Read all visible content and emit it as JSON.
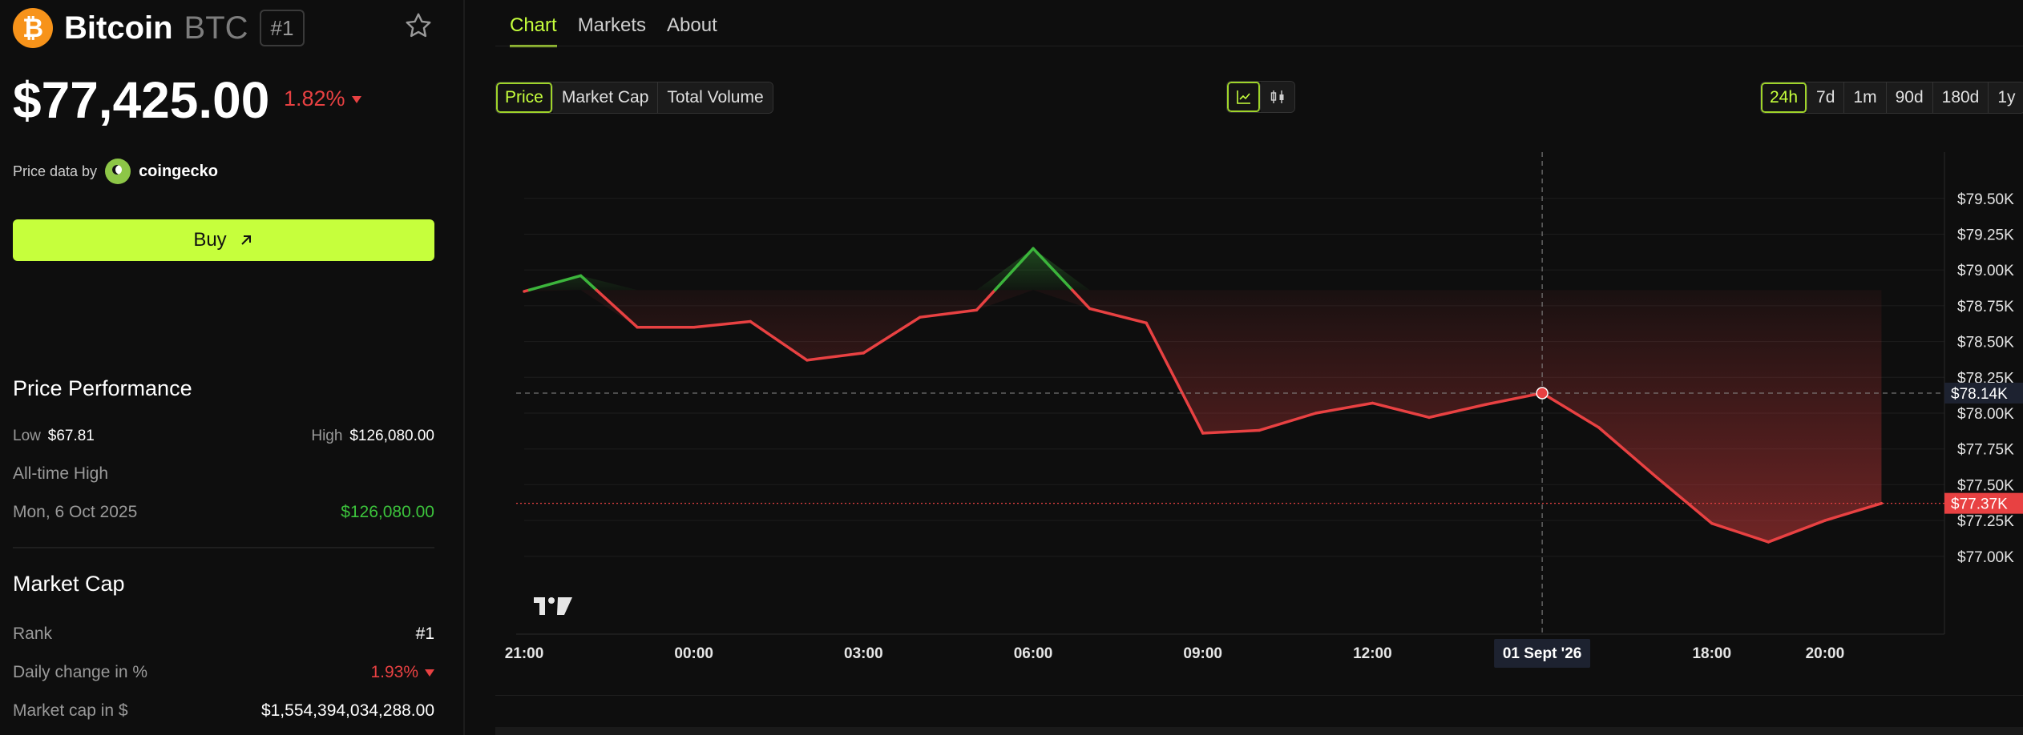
{
  "coin": {
    "name": "Bitcoin",
    "symbol": "BTC",
    "rank_badge": "#1",
    "logo_glyph": "₿",
    "price": "$77,425.00",
    "change": "1.82%"
  },
  "provider": {
    "label": "Price data by",
    "name": "coingecko"
  },
  "buy": {
    "label": "Buy"
  },
  "performance": {
    "title": "Price Performance",
    "low_label": "Low",
    "low_value": "$67.81",
    "high_label": "High",
    "high_value": "$126,080.00",
    "ath_label": "All-time High",
    "ath_date": "Mon, 6 Oct 2025",
    "ath_value": "$126,080.00"
  },
  "market_cap": {
    "title": "Market Cap",
    "rank_label": "Rank",
    "rank_value": "#1",
    "daily_label": "Daily change in %",
    "daily_value": "1.93%",
    "cap_label": "Market cap in $",
    "cap_value": "$1,554,394,034,288.00"
  },
  "tabs": [
    "Chart",
    "Markets",
    "About"
  ],
  "metric_buttons": [
    "Price",
    "Market Cap",
    "Total Volume"
  ],
  "range_buttons": [
    "24h",
    "7d",
    "1m",
    "90d",
    "180d",
    "1y"
  ],
  "colors": {
    "accent": "#c6ff3c",
    "up": "#3cb53c",
    "down": "#e84142",
    "bg": "#0e0e0e"
  },
  "chart_data": {
    "type": "line",
    "x_ticks": [
      "21:00",
      "00:00",
      "03:00",
      "06:00",
      "09:00",
      "12:00",
      "18:00",
      "20:00"
    ],
    "y_ticks": [
      "$79.50K",
      "$79.25K",
      "$79.00K",
      "$78.75K",
      "$78.50K",
      "$78.25K",
      "$78.00K",
      "$77.75K",
      "$77.50K",
      "$77.25K",
      "$77.00K"
    ],
    "ylim": [
      76.82,
      79.7
    ],
    "x": [
      21,
      22,
      23,
      24,
      25,
      26,
      27,
      28,
      29,
      30,
      31,
      32,
      33,
      34,
      35,
      36,
      37,
      38,
      39,
      40,
      41,
      42,
      43,
      44,
      45
    ],
    "values": [
      78.85,
      78.96,
      78.6,
      78.6,
      78.64,
      78.37,
      78.42,
      78.67,
      78.72,
      79.15,
      78.73,
      78.63,
      77.86,
      77.88,
      78.0,
      78.07,
      77.97,
      78.06,
      78.14,
      77.9,
      77.56,
      77.23,
      77.1,
      77.25,
      77.37
    ],
    "baseline": 78.86,
    "crosshair": {
      "x_label": "01 Sept '26",
      "y_label": "$78.14K",
      "x": 39,
      "value": 78.14
    },
    "last_label": "$77.37K",
    "last_value": 77.37
  }
}
